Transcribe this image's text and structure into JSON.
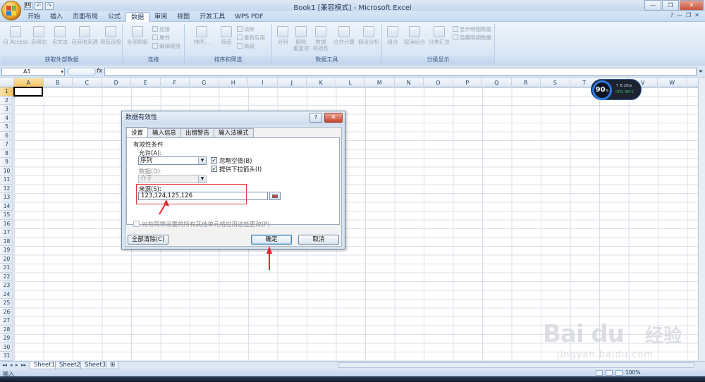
{
  "window": {
    "title": "Book1  [兼容模式] - Microsoft Excel",
    "min": "—",
    "max": "❐",
    "close": "✕"
  },
  "qat": [
    "💾",
    "↶",
    "↷"
  ],
  "ribbon_tabs": [
    "开始",
    "插入",
    "页面布局",
    "公式",
    "数据",
    "审阅",
    "视图",
    "开发工具",
    "WPS PDF"
  ],
  "active_tab_index": 4,
  "help": [
    "?",
    "—",
    "❐",
    "✕"
  ],
  "ribbon": {
    "groups": [
      {
        "label": "获取外部数据",
        "buttons": [
          "自 Access",
          "自网站",
          "自文本",
          "自其他来源",
          "现有连接"
        ]
      },
      {
        "label": "连接",
        "buttons": [
          "全部刷新"
        ],
        "small": [
          "连接",
          "属性",
          "编辑链接"
        ]
      },
      {
        "label": "排序和筛选",
        "buttons": [
          "排序...",
          "筛选"
        ],
        "small": [
          "清除",
          "重新应用",
          "高级"
        ]
      },
      {
        "label": "数据工具",
        "buttons": [
          "分列",
          "删除\n重复项",
          "数据\n有效性",
          "合并计算",
          "假设分析"
        ]
      },
      {
        "label": "分级显示",
        "buttons": [
          "组合",
          "取消组合",
          "分类汇总"
        ],
        "small": [
          "显示明细数据",
          "隐藏明细数据"
        ]
      }
    ]
  },
  "formula_bar": {
    "name_box": "A1",
    "fx": "fx",
    "content": ""
  },
  "columns": [
    "A",
    "B",
    "C",
    "D",
    "E",
    "F",
    "G",
    "H",
    "I",
    "J",
    "K",
    "L",
    "M",
    "N",
    "O",
    "P",
    "Q",
    "R",
    "S",
    "T",
    "U",
    "V",
    "W"
  ],
  "rows": [
    "1",
    "2",
    "3",
    "4",
    "5",
    "6",
    "7",
    "8",
    "9",
    "10",
    "11",
    "12",
    "13",
    "14",
    "15",
    "16",
    "17",
    "18",
    "19",
    "20",
    "21",
    "22",
    "23",
    "24",
    "25",
    "26",
    "27",
    "28",
    "29",
    "30",
    "31"
  ],
  "sheets": [
    "Sheet1",
    "Sheet2",
    "Sheet3"
  ],
  "sheet_nav": [
    "◂◂",
    "◂",
    "▸",
    "▸▸"
  ],
  "status": {
    "mode": "输入",
    "zoom": "100%"
  },
  "perf_widget": {
    "value": "90",
    "unit": "%",
    "net": "↑ 8.2K/s",
    "cpu": "CPU 39°C"
  },
  "dialog": {
    "title": "数据有效性",
    "help": "?",
    "close": "✕",
    "tabs": [
      "设置",
      "输入信息",
      "出错警告",
      "输入法模式"
    ],
    "section": "有效性条件",
    "allow_label": "允许(A):",
    "allow_value": "序列",
    "data_label": "数据(D):",
    "data_value": "介于",
    "ignore_blank": {
      "label": "忽略空值(B)",
      "checked": true
    },
    "dropdown_arrow": {
      "label": "提供下拉箭头(I)",
      "checked": true
    },
    "source_label": "来源(S):",
    "source_value": "123,124,125,126",
    "apply_all": {
      "label": "对有同样设置的所有其他单元格应用这些更改(P)",
      "checked": false
    },
    "clear_all": "全部清除(C)",
    "ok": "确定",
    "cancel": "取消"
  },
  "watermark": {
    "brand": "Bai du",
    "cn": "经验",
    "url": "jingyan.baidu.com"
  },
  "colors": {
    "highlight_red": "#e03a3a",
    "ribbon_blue": "#c9dbf0"
  }
}
